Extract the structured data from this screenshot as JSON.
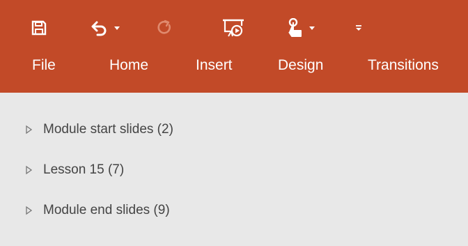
{
  "colors": {
    "ribbon": "#c24a28",
    "panel": "#e8e8e8",
    "text": "#444444",
    "ribbon_text": "#ffffff"
  },
  "quick_access": {
    "items": [
      {
        "name": "save",
        "icon": "save-icon"
      },
      {
        "name": "undo",
        "icon": "undo-icon",
        "has_dropdown": true
      },
      {
        "name": "redo",
        "icon": "redo-icon",
        "disabled": true
      },
      {
        "name": "present",
        "icon": "slideshow-icon"
      },
      {
        "name": "touch-mode",
        "icon": "touch-hand-icon",
        "has_dropdown": true
      },
      {
        "name": "customize",
        "icon": "customize-qat-icon"
      }
    ]
  },
  "tabs": {
    "file": "File",
    "home": "Home",
    "insert": "Insert",
    "design": "Design",
    "transitions": "Transitions"
  },
  "sections": [
    {
      "label": "Module start slides (2)",
      "expanded": false
    },
    {
      "label": "Lesson 15 (7)",
      "expanded": false
    },
    {
      "label": "Module end slides (9)",
      "expanded": false
    }
  ]
}
